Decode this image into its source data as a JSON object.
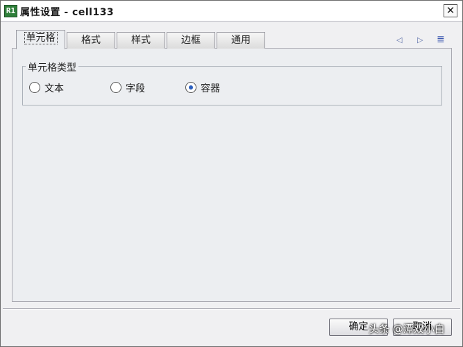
{
  "window": {
    "icon_text": "R1",
    "title": "属性设置 - cell133",
    "close_glyph": "✕"
  },
  "tabs": [
    {
      "label": "单元格",
      "active": true
    },
    {
      "label": "格式",
      "active": false
    },
    {
      "label": "样式",
      "active": false
    },
    {
      "label": "边框",
      "active": false
    },
    {
      "label": "通用",
      "active": false
    }
  ],
  "tab_nav": {
    "prev_icon": "triangle-left-icon",
    "next_icon": "triangle-right-icon",
    "menu_icon": "list-icon",
    "prev_glyph": "◁",
    "next_glyph": "▷",
    "menu_glyph": "≣"
  },
  "cell_type_group": {
    "label": "单元格类型",
    "options": [
      {
        "label": "文本",
        "checked": false
      },
      {
        "label": "字段",
        "checked": false
      },
      {
        "label": "容器",
        "checked": true
      }
    ]
  },
  "buttons": {
    "ok_label": "确定",
    "cancel_label": "取消"
  },
  "watermark": "头条 @潭双小白",
  "colors": {
    "accent": "#2a5fbf",
    "icon_bg": "#2f7f3a"
  }
}
